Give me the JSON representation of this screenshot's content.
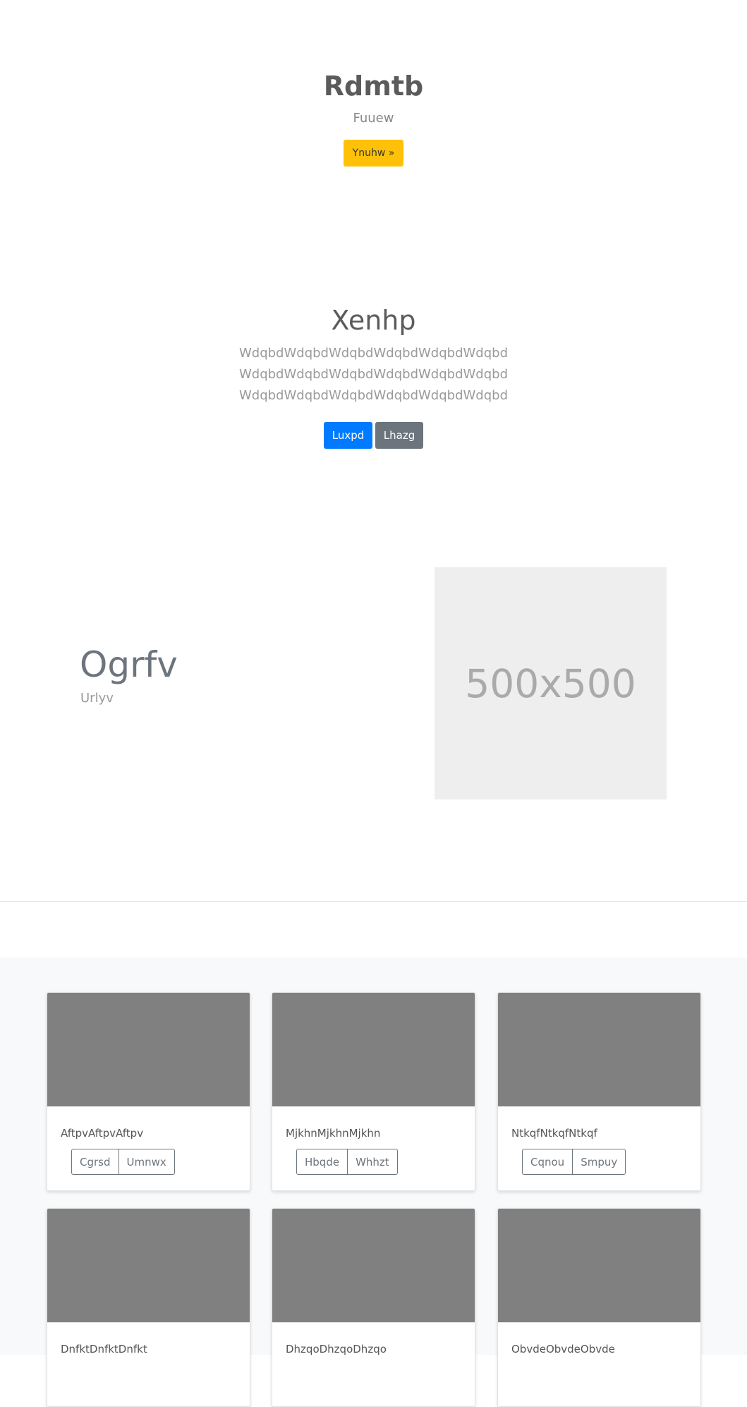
{
  "hero": {
    "title": "Rdmtb",
    "subtitle": "Fuuew",
    "button_label": "Ynuhw »",
    "button_color": "#ffc107"
  },
  "section2": {
    "title": "Xenhp",
    "lines": [
      "WdqbdWdqbdWdqbdWdqbdWdqbdWdqbd",
      "WdqbdWdqbdWdqbdWdqbdWdqbdWdqbd",
      "WdqbdWdqbdWdqbdWdqbdWdqbdWdqbd"
    ],
    "primary_label": "Luxpd",
    "secondary_label": "Lhazg",
    "primary_color": "#007bff",
    "secondary_color": "#6c757d"
  },
  "feature": {
    "title": "Ogrfv",
    "subtitle": "Urlyv",
    "image_label": "500x500"
  },
  "cards": [
    {
      "text": "AftpvAftpvAftpv",
      "buttons": [
        "Cgrsd",
        "Umnwx"
      ]
    },
    {
      "text": "MjkhnMjkhnMjkhn",
      "buttons": [
        "Hbqde",
        "Whhzt"
      ]
    },
    {
      "text": "NtkqfNtkqfNtkqf",
      "buttons": [
        "Cqnou",
        "Smpuy"
      ]
    },
    {
      "text": "DnfktDnfktDnfkt",
      "buttons": []
    },
    {
      "text": "DhzqoDhzqoDhzqo",
      "buttons": []
    },
    {
      "text": "ObvdeObvdeObvde",
      "buttons": []
    }
  ]
}
